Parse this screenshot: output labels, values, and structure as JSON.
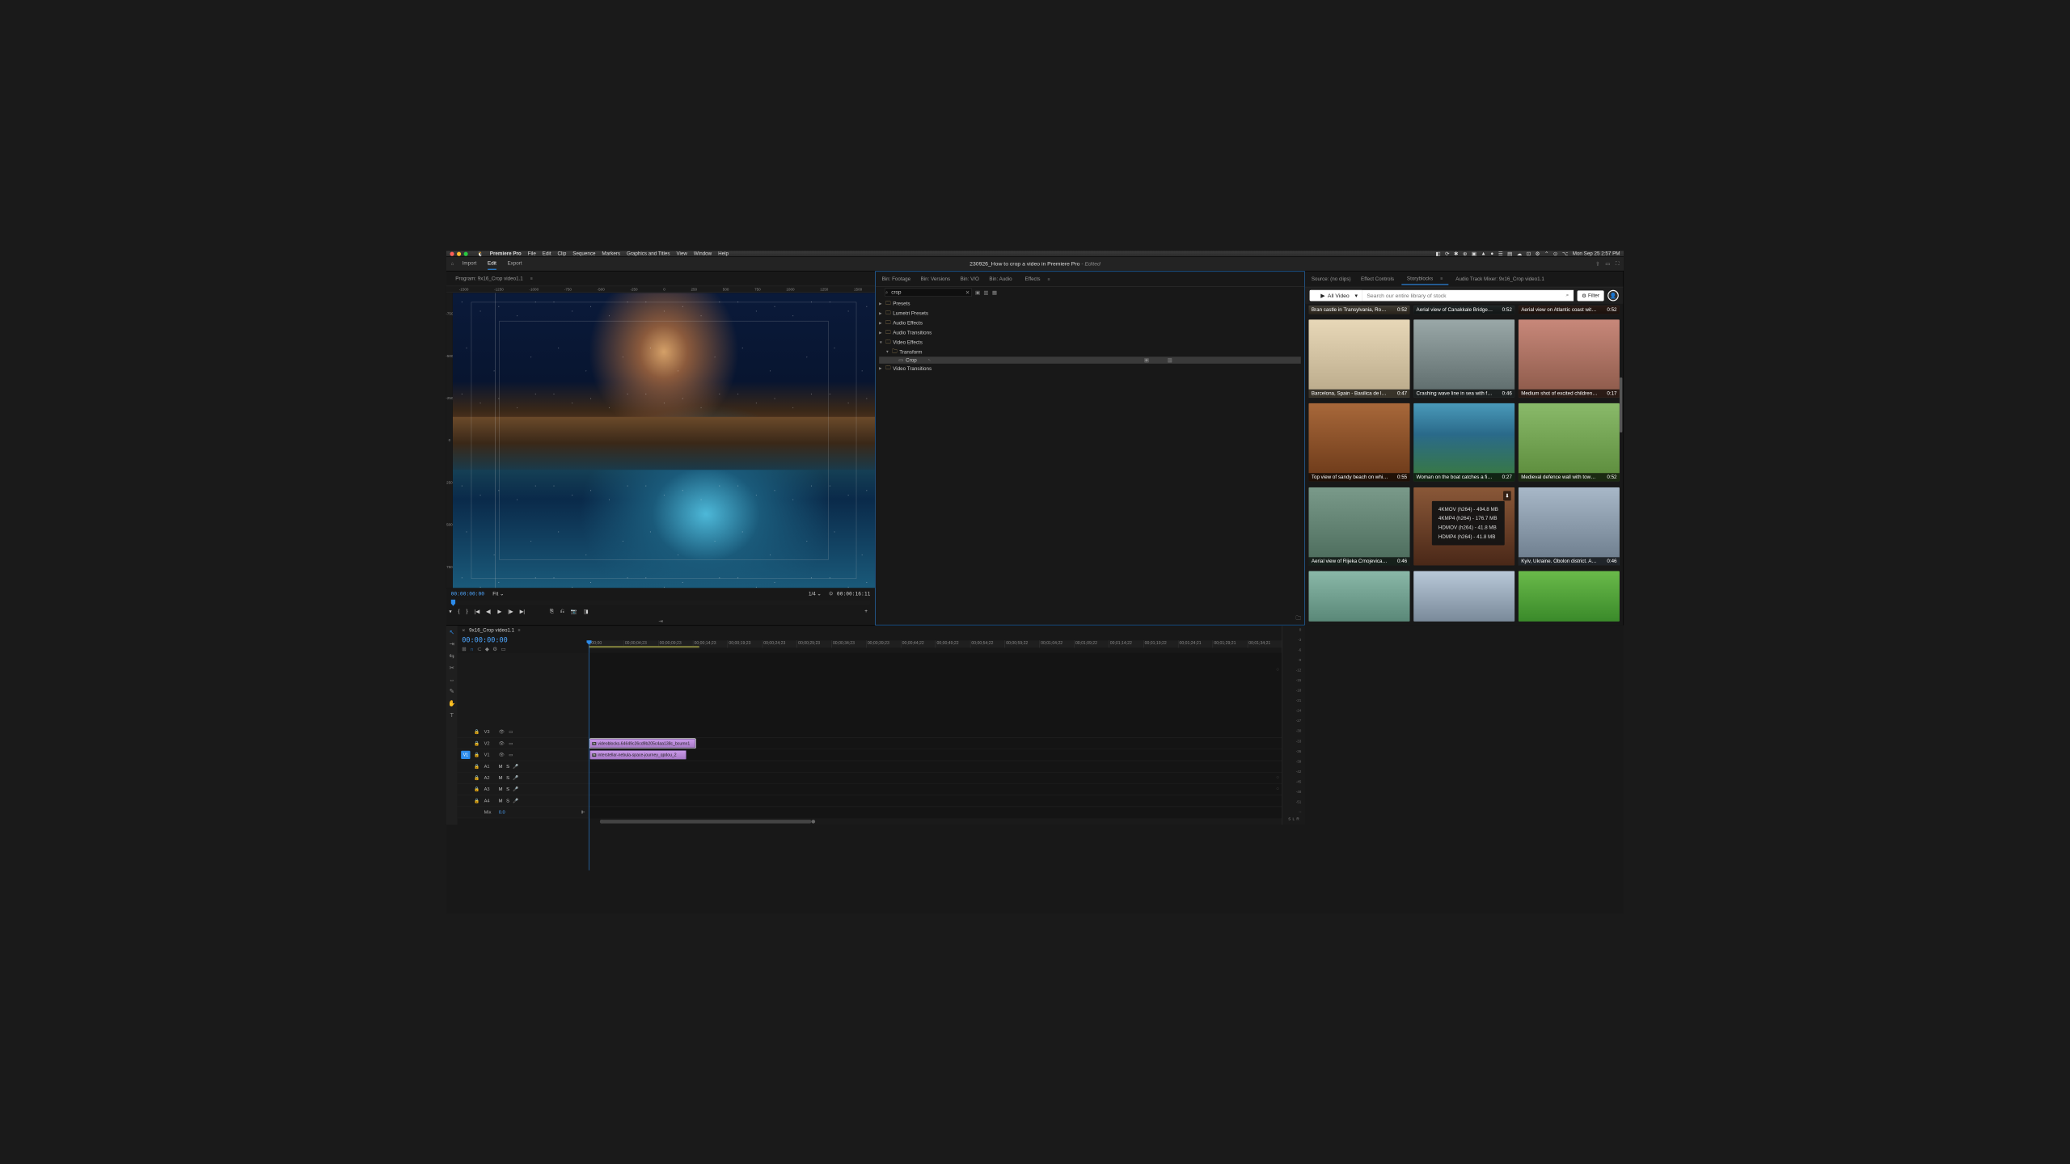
{
  "macos": {
    "app_name": "Premiere Pro",
    "menus": [
      "File",
      "Edit",
      "Clip",
      "Sequence",
      "Markers",
      "Graphics and Titles",
      "View",
      "Window",
      "Help"
    ],
    "clock": "Mon Sep 25  2:57 PM"
  },
  "header": {
    "modes": {
      "import": "Import",
      "edit": "Edit",
      "export": "Export"
    },
    "doc_title": "230926_How to crop a video in Premiere Pro",
    "edited": "Edited"
  },
  "effects_panel": {
    "tabs": {
      "footage": "Bin: Footage",
      "versions": "Bin: Versions",
      "vo": "Bin: V/O",
      "audio": "Bin: Audio",
      "effects": "Effects"
    },
    "search_value": "crop",
    "tree": {
      "presets": "Presets",
      "lumetri": "Lumetri Presets",
      "audio_fx": "Audio Effects",
      "audio_tr": "Audio Transitions",
      "video_fx": "Video Effects",
      "transform": "Transform",
      "crop": "Crop",
      "video_tr": "Video Transitions"
    }
  },
  "source_panel": {
    "tabs": {
      "source": "Source: (no clips)",
      "effect_controls": "Effect Controls",
      "storyblocks": "Storyblocks",
      "audio_mixer": "Audio Track Mixer: 9x16_Crop video1.1"
    },
    "dropdown": "All Video",
    "search_placeholder": "Search our entire library of stock",
    "filter": "Filter",
    "tiles": [
      {
        "title": "Bran castle in Transylvania, Romania",
        "dur": "0:52",
        "g": "g-castle"
      },
      {
        "title": "Aerial view of Canakkale Bridge cr...",
        "dur": "0:52",
        "g": "g-wave"
      },
      {
        "title": "Aerial view on Atlantic coast with r...",
        "dur": "0:52",
        "g": "g-child"
      },
      {
        "title": "Barcelona, Spain - Basilica de la Sa...",
        "dur": "0:47",
        "g": "g-barca"
      },
      {
        "title": "Crashing wave line in sea with foa...",
        "dur": "0:46",
        "g": "g-foam"
      },
      {
        "title": "Medium shot of excited children in ...",
        "dur": "0:17",
        "g": "g-kids"
      },
      {
        "title": "Top view of sandy beach on which...",
        "dur": "0:55",
        "g": "g-sand"
      },
      {
        "title": "Woman on the boat catches a fish ...",
        "dur": "0:27",
        "g": "g-boat"
      },
      {
        "title": "Medieval defence wall with tower ...",
        "dur": "0:52",
        "g": "g-tower"
      },
      {
        "title": "Aerial view of Rijeka Crnojevica - b...",
        "dur": "0:46",
        "g": "g-rijeka"
      },
      {
        "title": "",
        "dur": "",
        "g": "g-sunset"
      },
      {
        "title": "Kyiv, Ukraine. Obolon district. Aeri...",
        "dur": "0:46",
        "g": "g-kyiv"
      },
      {
        "title": "",
        "dur": "",
        "g": "g-coast"
      },
      {
        "title": "",
        "dur": "",
        "g": "g-ice"
      },
      {
        "title": "",
        "dur": "",
        "g": "g-golf"
      }
    ],
    "download_options": [
      "4KMOV (h264) - 494.8 MB",
      "4KMP4 (h264) - 176.7 MB",
      "HDMOV (h264) - 41.8 MB",
      "HDMP4 (h264) - 41.8 MB"
    ]
  },
  "program_panel": {
    "tab": "Program: 9x16_Crop video1.1",
    "ruler_h": [
      "-1500",
      "-1250",
      "-1000",
      "-750",
      "-500",
      "-250",
      "0",
      "250",
      "500",
      "750",
      "1000",
      "1250",
      "1500"
    ],
    "ruler_v": [
      "-750",
      "-500",
      "-250",
      "0",
      "250",
      "500",
      "750"
    ],
    "tc_left": "00:00:00:00",
    "fit": "Fit",
    "scale": "1/4",
    "tc_right": "00:00:16:11"
  },
  "timeline": {
    "seq_name": "9x16_Crop video1.1",
    "tc": "00:00:00:00",
    "ruler": [
      ";00;00",
      "00;00;04;23",
      "00;00;09;23",
      "00;00;14;23",
      "00;00;19;23",
      "00;00;24;23",
      "00;00;29;23",
      "00;00;34;23",
      "00;00;39;23",
      "00;00;44;22",
      "00;00;49;22",
      "00;00;54;22",
      "00;00;59;22",
      "00;01;04;22",
      "00;01;09;22",
      "00;01;14;22",
      "00;01;19;22",
      "00;01;24;21",
      "00;01;29;21",
      "00;01;34;21"
    ],
    "tracks": {
      "v3": "V3",
      "v2": "V2",
      "v1": "V1",
      "a1": "A1",
      "a2": "A2",
      "a3": "A3",
      "a4": "A4",
      "mix": "Mix"
    },
    "mix_val": "0.0",
    "clips": {
      "v2": "videoblocks-64649c26cd9b205c4aa138c_bcumn1",
      "v1": "interstellar-nebula-space-journey_qpdou_2"
    },
    "meter_scale": [
      "0",
      "-3",
      "-6",
      "-9",
      "-12",
      "-15",
      "-18",
      "-21",
      "-24",
      "-27",
      "-30",
      "-33",
      "-36",
      "-39",
      "-42",
      "-45",
      "-48",
      "-51",
      "--"
    ],
    "meter_labels": {
      "s": "S",
      "l": "L",
      "r": "R"
    }
  }
}
